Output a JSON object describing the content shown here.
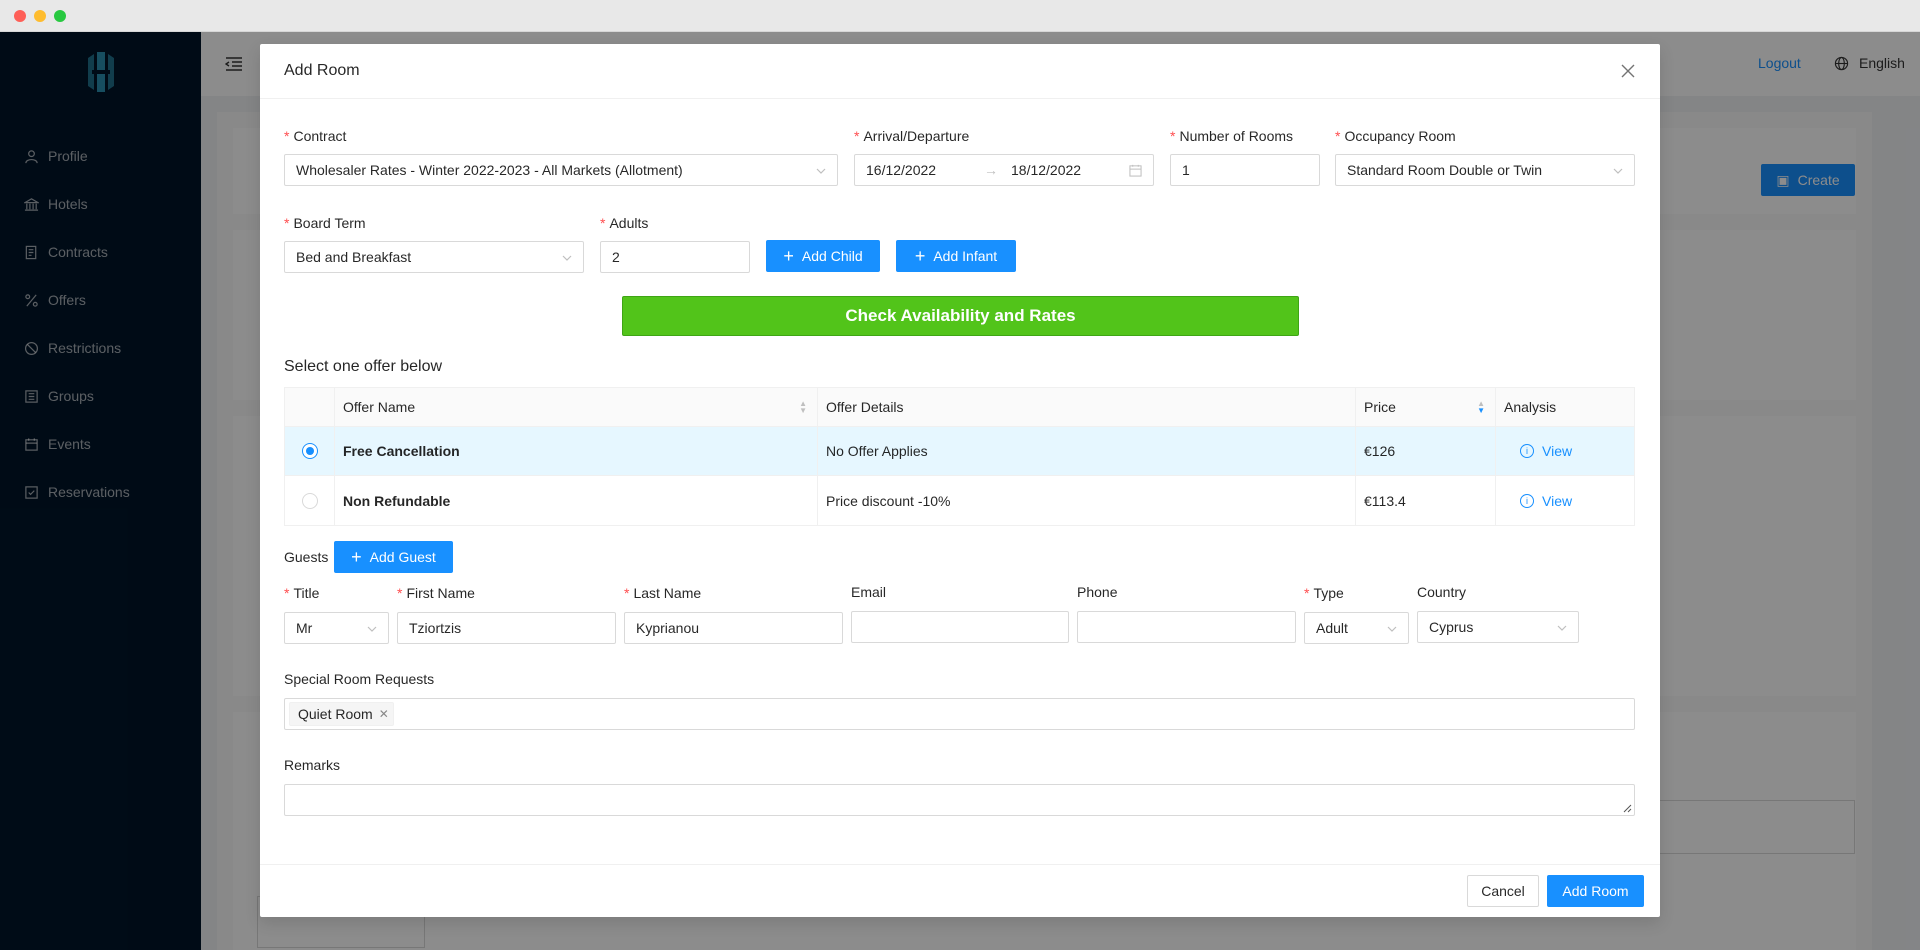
{
  "sidebar": {
    "items": [
      {
        "label": "Profile",
        "icon": "user-icon"
      },
      {
        "label": "Hotels",
        "icon": "bank-icon"
      },
      {
        "label": "Contracts",
        "icon": "file-icon"
      },
      {
        "label": "Offers",
        "icon": "percent-icon"
      },
      {
        "label": "Restrictions",
        "icon": "stop-icon"
      },
      {
        "label": "Groups",
        "icon": "group-icon"
      },
      {
        "label": "Events",
        "icon": "calendar-icon"
      },
      {
        "label": "Reservations",
        "icon": "check-square-icon"
      }
    ]
  },
  "topbar": {
    "logout": "Logout",
    "language": "English"
  },
  "background": {
    "create_label": "Create"
  },
  "modal": {
    "title": "Add Room",
    "contract": {
      "label": "Contract",
      "value": "Wholesaler Rates - Winter 2022-2023 - All Markets (Allotment)"
    },
    "dates": {
      "label": "Arrival/Departure",
      "arrival": "16/12/2022",
      "departure": "18/12/2022"
    },
    "rooms": {
      "label": "Number of Rooms",
      "value": "1"
    },
    "occupancy": {
      "label": "Occupancy Room",
      "value": "Standard Room Double or Twin"
    },
    "board": {
      "label": "Board Term",
      "value": "Bed and Breakfast"
    },
    "adults": {
      "label": "Adults",
      "value": "2"
    },
    "add_child": "Add Child",
    "add_infant": "Add Infant",
    "check_btn": "Check Availability and Rates",
    "offers_heading": "Select one offer below",
    "table": {
      "headers": [
        "Offer Name",
        "Offer Details",
        "Price",
        "Analysis"
      ],
      "rows": [
        {
          "name": "Free Cancellation",
          "details": "No Offer Applies",
          "price": "€126",
          "analysis": "View",
          "selected": true
        },
        {
          "name": "Non Refundable",
          "details": "Price discount -10%",
          "price": "€113.4",
          "analysis": "View",
          "selected": false
        }
      ]
    },
    "guests": {
      "label": "Guests",
      "add_guest": "Add Guest",
      "title": {
        "label": "Title",
        "value": "Mr"
      },
      "first_name": {
        "label": "First Name",
        "value": "Tziortzis"
      },
      "last_name": {
        "label": "Last Name",
        "value": "Kyprianou"
      },
      "email": {
        "label": "Email",
        "value": ""
      },
      "phone": {
        "label": "Phone",
        "value": ""
      },
      "type": {
        "label": "Type",
        "value": "Adult"
      },
      "country": {
        "label": "Country",
        "value": "Cyprus"
      }
    },
    "special_requests": {
      "label": "Special Room Requests",
      "tags": [
        "Quiet Room"
      ]
    },
    "remarks": {
      "label": "Remarks",
      "value": ""
    },
    "cancel": "Cancel",
    "add_room": "Add Room"
  },
  "colors": {
    "sidebar_bg": "#001529",
    "primary": "#1890ff",
    "check_green": "#52c41a",
    "selected_row": "#e6f7ff",
    "required": "#ff4d4f"
  }
}
